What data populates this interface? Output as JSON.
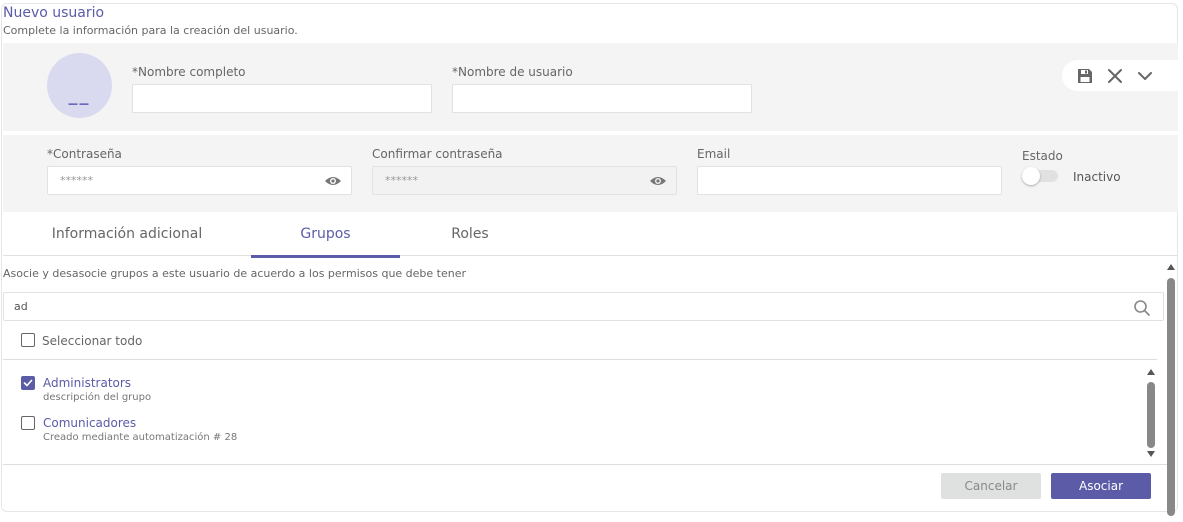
{
  "header": {
    "title": "Nuevo usuario",
    "subtitle": "Complete la información para la creación del usuario."
  },
  "avatar": {
    "initials": "__"
  },
  "form": {
    "full_name_label": "*Nombre completo",
    "full_name_value": "",
    "username_label": "*Nombre de usuario",
    "username_value": "",
    "password_label": "*Contraseña",
    "password_value": "******",
    "confirm_password_label": "Confirmar contraseña",
    "confirm_password_value": "******",
    "email_label": "Email",
    "email_value": "",
    "estado_label": "Estado",
    "estado_value": "Inactivo"
  },
  "actions": {
    "save": "save-icon",
    "close": "close-icon",
    "expand": "chevron-down-icon"
  },
  "tabs": [
    {
      "label": "Información adicional",
      "active": false
    },
    {
      "label": "Grupos",
      "active": true
    },
    {
      "label": "Roles",
      "active": false
    }
  ],
  "groups_panel": {
    "description": "Asocie y desasocie grupos a este usuario de acuerdo a los permisos que debe tener",
    "search_value": "ad",
    "select_all_label": "Seleccionar todo",
    "items": [
      {
        "name": "Administrators",
        "description": "descripción del grupo",
        "checked": true
      },
      {
        "name": "Comunicadores",
        "description": "Creado mediante automatización # 28",
        "checked": false
      }
    ]
  },
  "footer": {
    "cancel_label": "Cancelar",
    "associate_label": "Asociar"
  },
  "colors": {
    "accent": "#5b5ba8",
    "panel_bg": "#f3f4f3",
    "avatar_bg": "#d9daf0"
  }
}
